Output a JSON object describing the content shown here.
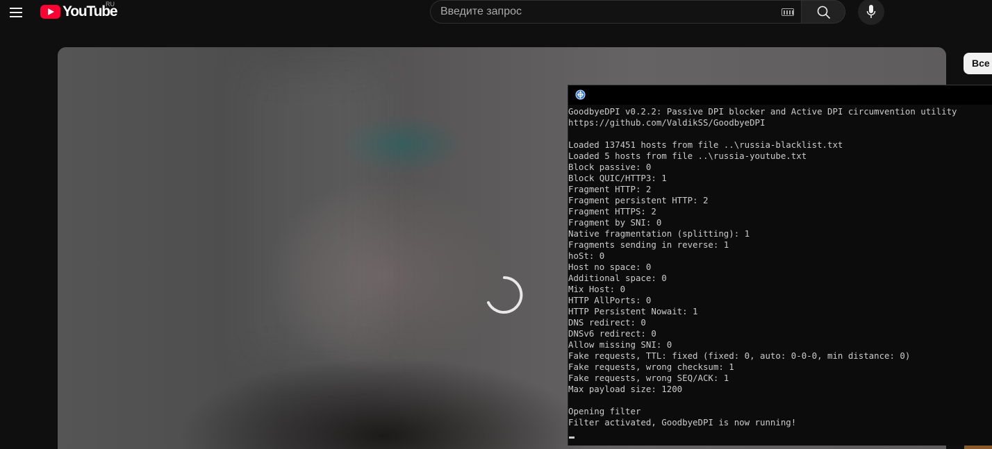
{
  "masthead": {
    "logo_text": "YouTube",
    "country_code": "RU",
    "search_placeholder": "Введите запрос"
  },
  "chips": {
    "all_label": "Все"
  },
  "colors": {
    "youtube_red": "#ff0033",
    "background": "#0f0f0f",
    "console_bg": "#0c0c0c",
    "console_text": "#cccccc"
  },
  "icons": {
    "menu": "hamburger-menu-icon",
    "search": "magnifier-search-icon",
    "keyboard": "keyboard-icon",
    "mic": "microphone-icon",
    "loading": "loading-spinner-icon",
    "console_app": "goodbyedpi-app-icon"
  },
  "console": {
    "lines": [
      "GoodbyeDPI v0.2.2: Passive DPI blocker and Active DPI circumvention utility",
      "https://github.com/ValdikSS/GoodbyeDPI",
      "",
      "Loaded 137451 hosts from file ..\\russia-blacklist.txt",
      "Loaded 5 hosts from file ..\\russia-youtube.txt",
      "Block passive: 0",
      "Block QUIC/HTTP3: 1",
      "Fragment HTTP: 2",
      "Fragment persistent HTTP: 2",
      "Fragment HTTPS: 2",
      "Fragment by SNI: 0",
      "Native fragmentation (splitting): 1",
      "Fragments sending in reverse: 1",
      "hoSt: 0",
      "Host no space: 0",
      "Additional space: 0",
      "Mix Host: 0",
      "HTTP AllPorts: 0",
      "HTTP Persistent Nowait: 1",
      "DNS redirect: 0",
      "DNSv6 redirect: 0",
      "Allow missing SNI: 0",
      "Fake requests, TTL: fixed (fixed: 0, auto: 0-0-0, min distance: 0)",
      "Fake requests, wrong checksum: 1",
      "Fake requests, wrong SEQ/ACK: 1",
      "Max payload size: 1200",
      "",
      "Opening filter",
      "Filter activated, GoodbyeDPI is now running!"
    ]
  }
}
